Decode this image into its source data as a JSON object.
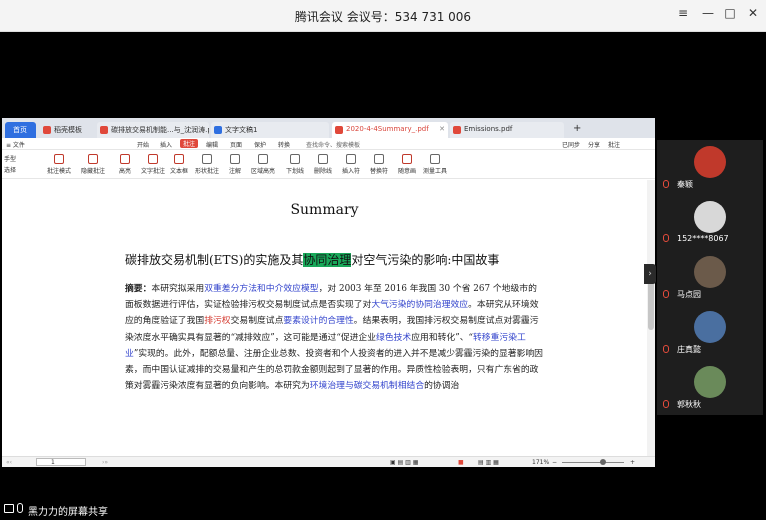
{
  "meeting": {
    "title": "腾讯会议 会议号：534 731 006"
  },
  "window_controls": {
    "menu": "≡",
    "minimize": "—",
    "maximize": "□",
    "close": "✕"
  },
  "wps": {
    "tabs": [
      {
        "label": "首页"
      },
      {
        "label": "稻壳模板"
      },
      {
        "label": "碳排放交易机制能...与_沈润涛.pdf"
      },
      {
        "label": "文字文稿1"
      },
      {
        "label": "2020-4-4Summary_.pdf"
      },
      {
        "label": "Emissions.pdf"
      }
    ],
    "new_tab": "+",
    "menu": [
      "≡ 文件",
      "开始",
      "插入",
      "批注",
      "编辑",
      "页面",
      "保护",
      "转换",
      "查找命令、搜索模板"
    ],
    "menu_right": [
      "已同步",
      "分享",
      "批注"
    ],
    "tools": [
      "手型",
      "选择",
      "批注模式",
      "隐藏批注",
      "高亮",
      "文字批注",
      "文本框",
      "形状批注",
      "注解",
      "区域高亮",
      "下划线",
      "删除线",
      "插入符",
      "替换符",
      "随意画",
      "测量工具"
    ],
    "status": {
      "page": "1",
      "zoom": "171%"
    }
  },
  "document": {
    "title": "Summary",
    "subtitle_pre": "碳排放交易机制(ETS)的实施及其",
    "subtitle_hl": "协同治理",
    "subtitle_post": "对空气污染的影响:中国故事",
    "abstract_label": "摘要：",
    "abstract_1": "本研究拟采用",
    "abstract_2": "双重差分方法和中介效应模型",
    "abstract_3": "，对 2003 年至 2016 年我国 30 个省 267 个地级市的面板数据进行评估，实证检验排污权交易制度试点是否实现了对",
    "abstract_4": "大气污染的协同治理效应",
    "abstract_5": "。本研究从环境效应的角度验证了我国",
    "abstract_6": "排污权",
    "abstract_7": "交易制度试点",
    "abstract_8": "要素设计的合理性",
    "abstract_9": "。结果表明，我国排污权交易制度试点对雾霾污染浓度水平确实具有显著的“减排效应”，这可能是通过“促进企业",
    "abstract_10": "绿色技术",
    "abstract_11": "应用和转化”、“",
    "abstract_12": "转移重污染工业",
    "abstract_13": "”实现的。此外，配额总量、注册企业总数、投资者和个人投资者的进入并不是减少雾霾污染的显著影响因素，而中国认证减排的交易量和产生的总罚款金额则起到了显著的作用。异质性检验表明，只有广东省的政策对雾霾污染浓度有显著的负向影响。本研究为",
    "abstract_14": "环境治理与碳交易机制相结合",
    "abstract_15": "的协调治"
  },
  "participants": [
    {
      "name": "秦颖",
      "avatar_color": "#c0392b"
    },
    {
      "name": "152****8067",
      "avatar_color": "#d8d8d8"
    },
    {
      "name": "马点园",
      "avatar_color": "#6b5a4a"
    },
    {
      "name": "庄真懿",
      "avatar_color": "#4a6fa0"
    },
    {
      "name": "郭秋秋",
      "avatar_color": "#6a8a5a"
    }
  ],
  "screen_share": {
    "label": "黑力力的屏幕共享"
  }
}
